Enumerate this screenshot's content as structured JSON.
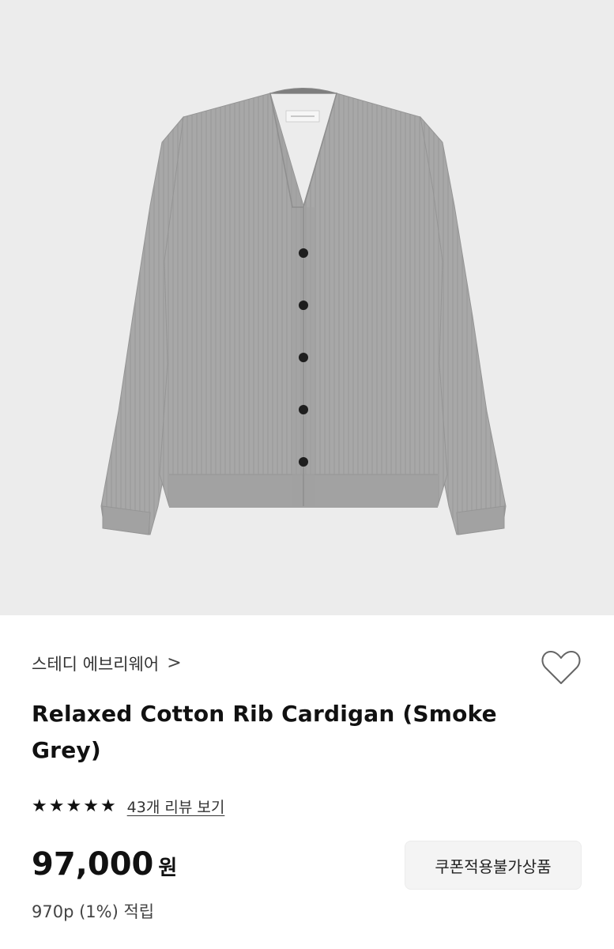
{
  "product_image": {
    "alt": "Relaxed Cotton Rib Cardigan (Smoke Grey)",
    "background_color": "#ececec",
    "garment_color": "#a6a6a6",
    "button_color": "#1e1e1e"
  },
  "brand": {
    "name": "스테디 에브리웨어",
    "chevron": ">"
  },
  "wishlist": {
    "icon": "heart-outline-icon"
  },
  "product": {
    "title": "Relaxed Cotton Rib Cardigan (Smoke Grey)"
  },
  "rating": {
    "stars": 5,
    "review_link": "43개 리뷰 보기"
  },
  "price": {
    "amount": "97,000",
    "currency": "원",
    "points": "970p (1%) 적립"
  },
  "coupon": {
    "label": "쿠폰적용불가상품"
  }
}
